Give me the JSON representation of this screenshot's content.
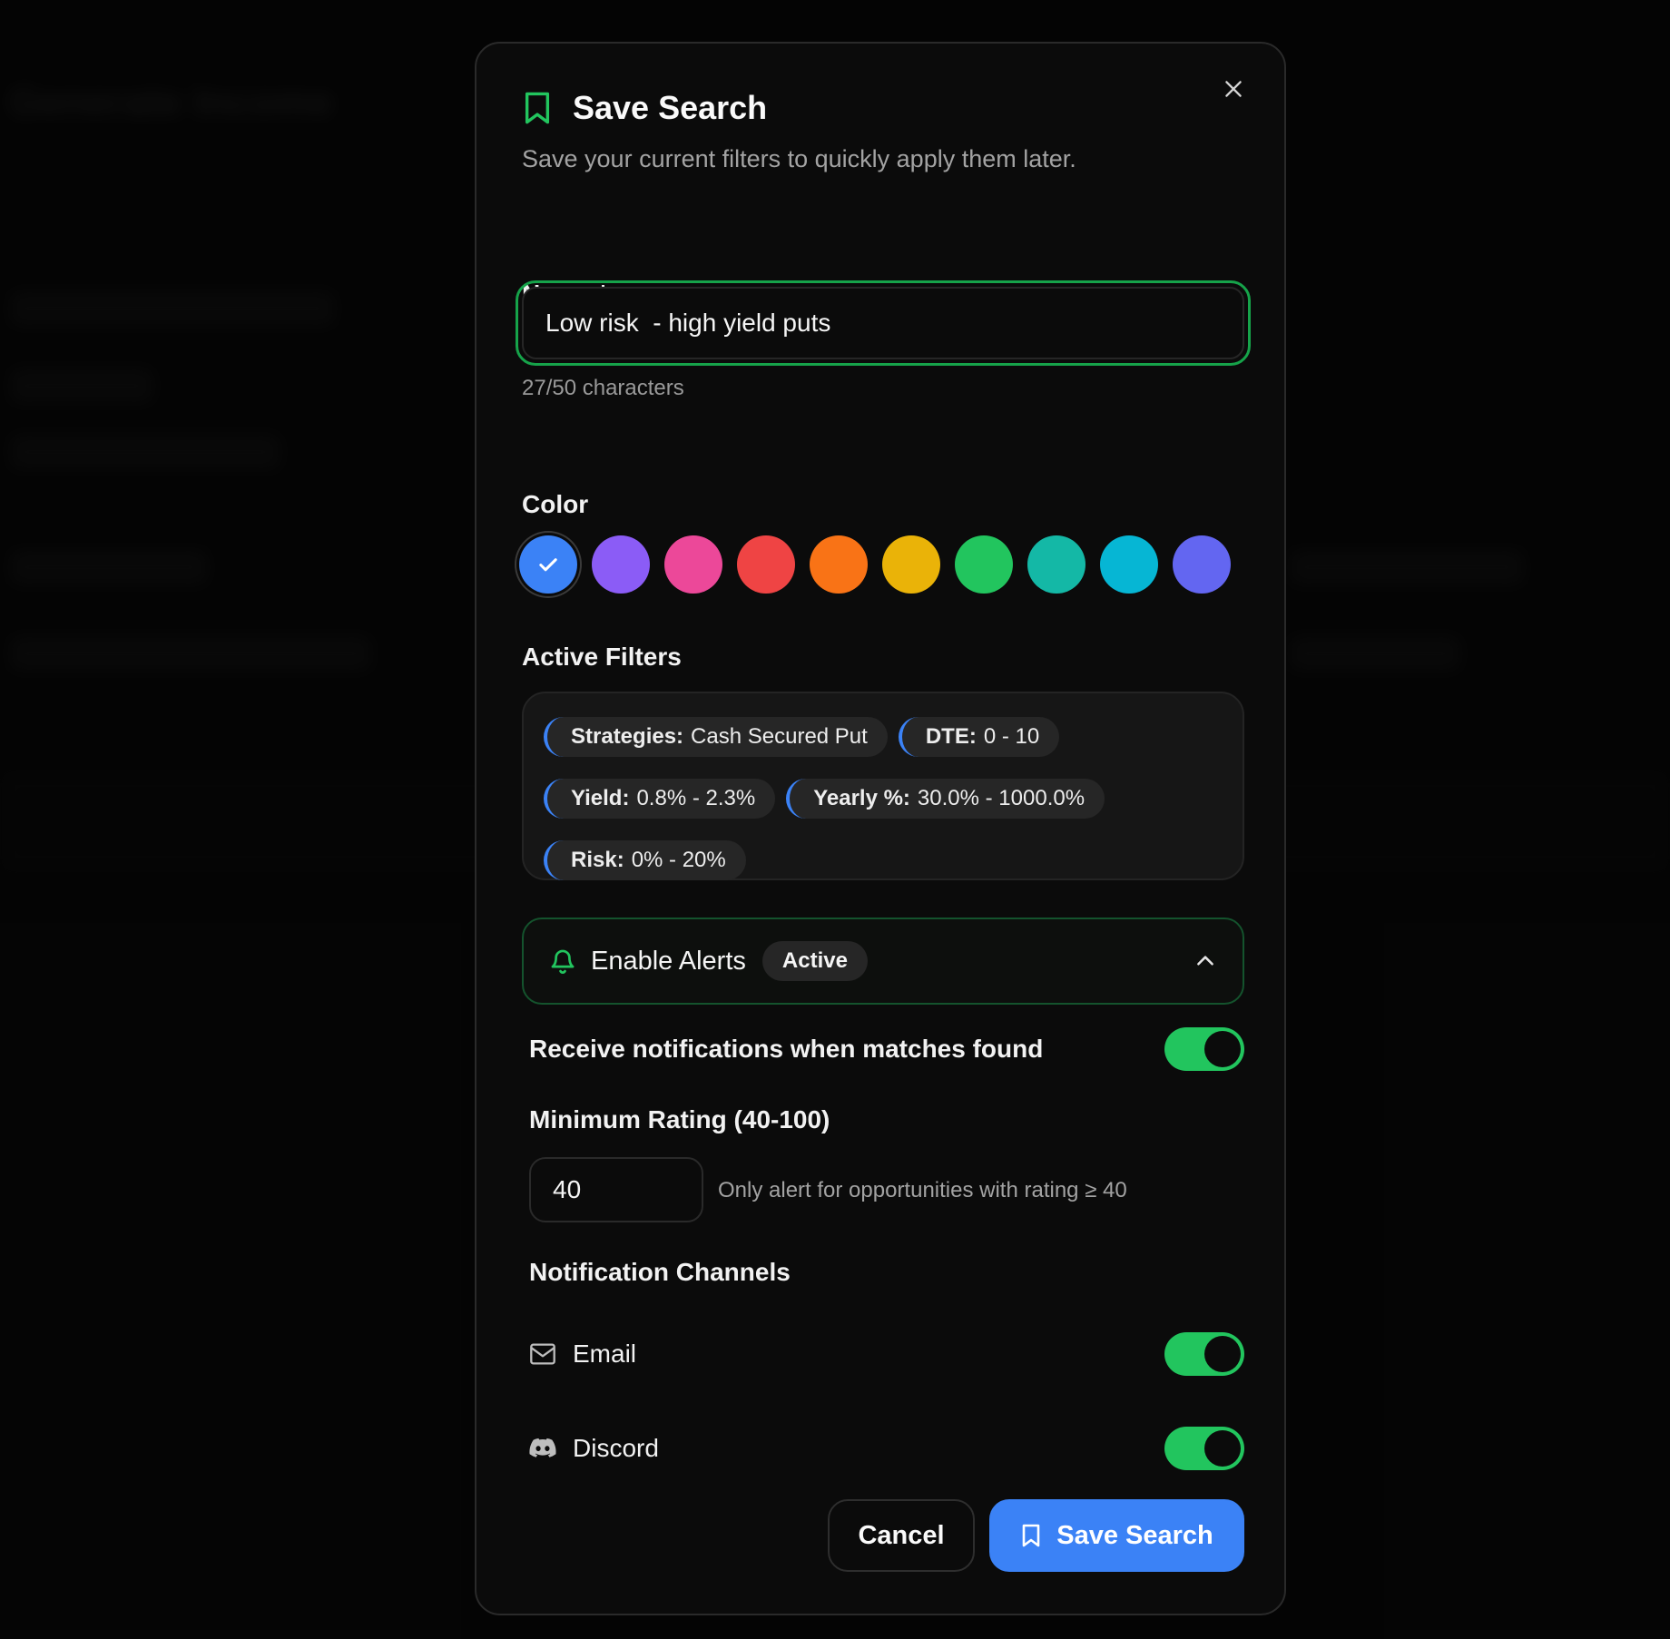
{
  "modal": {
    "title": "Save Search",
    "subtitle": "Save your current filters to quickly apply them later.",
    "close_icon": "close-icon"
  },
  "name_field": {
    "label": "Name *",
    "value": "Low risk  - high yield puts",
    "char_count": "27/50 characters"
  },
  "color": {
    "label": "Color",
    "selected": "#3b82f6",
    "swatches": [
      "#3b82f6",
      "#8b5cf6",
      "#ec4899",
      "#ef4444",
      "#f97316",
      "#eab308",
      "#22c55e",
      "#14b8a6",
      "#06b6d4",
      "#6366f1"
    ]
  },
  "active_filters": {
    "label": "Active Filters",
    "chips": [
      {
        "key": "Strategies:",
        "value": "Cash Secured Put"
      },
      {
        "key": "DTE:",
        "value": "0 - 10"
      },
      {
        "key": "Yield:",
        "value": "0.8% - 2.3%"
      },
      {
        "key": "Yearly %:",
        "value": "30.0% - 1000.0%"
      },
      {
        "key": "Risk:",
        "value": "0% - 20%"
      }
    ]
  },
  "alerts": {
    "title": "Enable Alerts",
    "badge": "Active",
    "notify_label": "Receive notifications when matches found",
    "notify_enabled": true,
    "min_rating_label": "Minimum Rating (40-100)",
    "min_rating_value": "40",
    "min_rating_hint": "Only alert for opportunities with rating ≥ 40",
    "channels_label": "Notification Channels",
    "channels": [
      {
        "name": "Email",
        "icon": "mail-icon",
        "enabled": true
      },
      {
        "name": "Discord",
        "icon": "discord-icon",
        "enabled": true
      }
    ]
  },
  "footer": {
    "cancel_label": "Cancel",
    "save_label": "Save Search"
  },
  "accent": {
    "green": "#22c55e",
    "blue": "#3b82f6"
  }
}
